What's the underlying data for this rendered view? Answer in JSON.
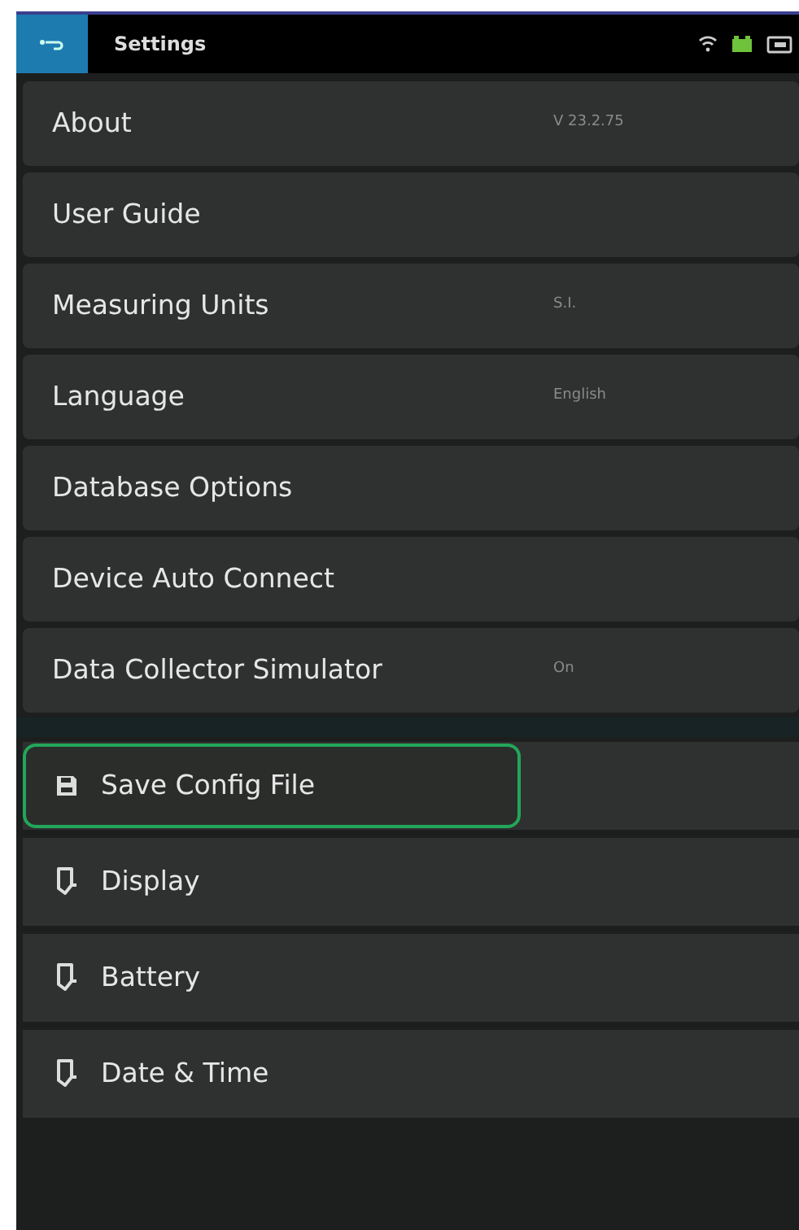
{
  "header": {
    "title": "Settings"
  },
  "settings": [
    {
      "label": "About",
      "value": "V 23.2.75",
      "selected": false
    },
    {
      "label": "User Guide",
      "selected": false
    },
    {
      "label": "Measuring Units",
      "value": "S.I.",
      "selected": false
    },
    {
      "label": "Language",
      "value": "English",
      "selected": false
    },
    {
      "label": "Database Options",
      "selected": false
    },
    {
      "label": "Device Auto Connect",
      "selected": false
    },
    {
      "label": "Data Collector Simulator",
      "value": "On",
      "selected": false
    }
  ],
  "tools": [
    {
      "kind": "save",
      "label": "Save Config File",
      "selected": true
    },
    {
      "kind": "device",
      "label": "Display",
      "selected": false
    },
    {
      "kind": "device",
      "label": "Battery",
      "selected": false
    },
    {
      "kind": "device",
      "label": "Date & Time",
      "selected": false
    }
  ]
}
